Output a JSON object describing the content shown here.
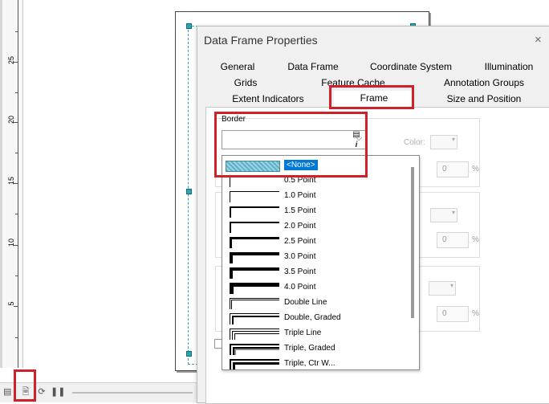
{
  "ruler": {
    "labels": [
      "25",
      "20",
      "15",
      "10",
      "5"
    ]
  },
  "statusbar": {
    "icons": [
      "layout-view-icon",
      "refresh-icon",
      "pause-icon"
    ]
  },
  "dialog": {
    "title": "Data Frame Properties",
    "close_glyph": "×",
    "tabs": [
      {
        "label": "General"
      },
      {
        "label": "Data Frame"
      },
      {
        "label": "Coordinate System"
      },
      {
        "label": "Illumination"
      },
      {
        "label": "Grids"
      },
      {
        "label": "Feature Cache"
      },
      {
        "label": "Annotation Groups"
      },
      {
        "label": "Extent Indicators"
      },
      {
        "label": "Frame",
        "active": true
      },
      {
        "label": "Size and Position"
      }
    ],
    "border": {
      "group_label": "Border",
      "color_label": "Color:",
      "gap_value": "0",
      "gap_unit": "%"
    },
    "background": {
      "gap_value": "0",
      "gap_unit": "%"
    },
    "drop_shadow": {
      "gap_value": "0",
      "gap_unit": "%"
    }
  },
  "border_dropdown": {
    "selected": "<None>",
    "items": [
      {
        "label": "<None>",
        "weight": 0
      },
      {
        "label": "0.5 Point",
        "weight": 0.5
      },
      {
        "label": "1.0 Point",
        "weight": 1
      },
      {
        "label": "1.5 Point",
        "weight": 1.5
      },
      {
        "label": "2.0 Point",
        "weight": 2
      },
      {
        "label": "2.5 Point",
        "weight": 2.5
      },
      {
        "label": "3.0 Point",
        "weight": 3
      },
      {
        "label": "3.5 Point",
        "weight": 3.5
      },
      {
        "label": "4.0 Point",
        "weight": 4
      },
      {
        "label": "Double Line",
        "weight": "double"
      },
      {
        "label": "Double, Graded",
        "weight": "double-graded"
      },
      {
        "label": "Triple Line",
        "weight": "triple"
      },
      {
        "label": "Triple, Graded",
        "weight": "triple-graded"
      },
      {
        "label": "Triple, Ctr W...",
        "weight": "triple-ctr"
      }
    ]
  },
  "colors": {
    "highlight_box": "#d0202a",
    "selection_handle": "#2ea3b5",
    "list_selection": "#0078d7"
  }
}
